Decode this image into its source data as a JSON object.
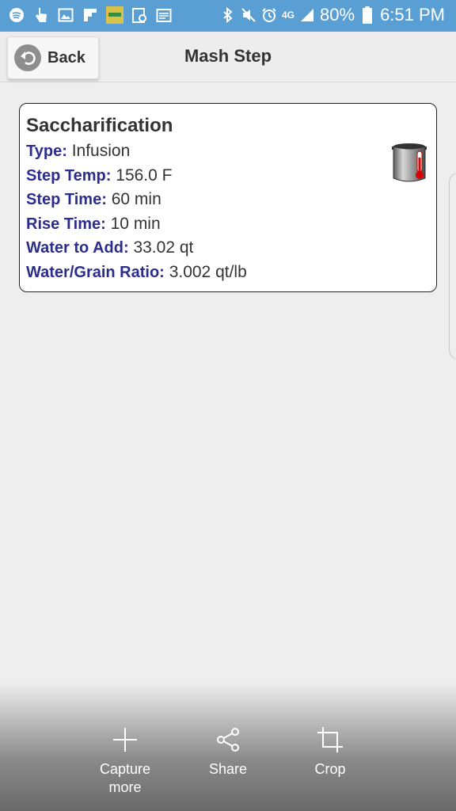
{
  "status_bar": {
    "battery": "80%",
    "time": "6:51 PM",
    "network": "4G",
    "left_icons": [
      "spotify-icon",
      "hand-icon",
      "image-icon",
      "flipboard-icon",
      "app-thumbnail-icon",
      "clipboard-icon",
      "calendar-icon"
    ],
    "right_icons": [
      "bluetooth-icon",
      "mute-icon",
      "alarm-icon",
      "lte-icon",
      "signal-icon",
      "battery-icon"
    ]
  },
  "header": {
    "back_label": "Back",
    "title": "Mash Step"
  },
  "step": {
    "name": "Saccharification",
    "type_label": "Type:",
    "type_value": "Infusion",
    "temp_label": "Step Temp:",
    "temp_value": "156.0 F",
    "time_label": "Step Time:",
    "time_value": "60 min",
    "rise_label": "Rise Time:",
    "rise_value": "10 min",
    "water_label": "Water to Add:",
    "water_value": "33.02 qt",
    "ratio_label": "Water/Grain Ratio:",
    "ratio_value": "3.002 qt/lb"
  },
  "capture_bar": {
    "capture_line1": "Capture",
    "capture_line2": "more",
    "share_label": "Share",
    "crop_label": "Crop"
  },
  "colors": {
    "status_bar": "#5a9fd4",
    "label_blue": "#2c2c8c",
    "background": "#eeeeee"
  }
}
